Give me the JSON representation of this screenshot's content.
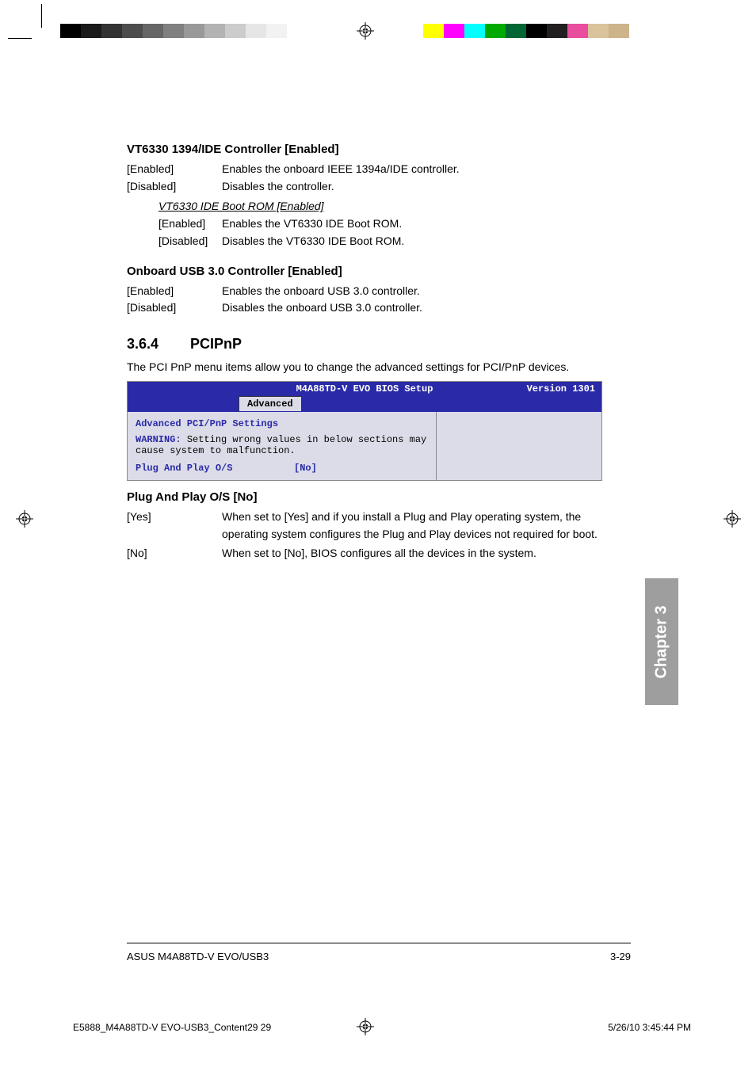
{
  "sections": {
    "vt6330": {
      "heading": "VT6330 1394/IDE Controller [Enabled]",
      "rows": [
        {
          "key": "[Enabled]",
          "val": "Enables the onboard IEEE 1394a/IDE controller."
        },
        {
          "key": "[Disabled]",
          "val": "Disables the controller."
        }
      ],
      "sub": {
        "heading": "VT6330 IDE Boot ROM [Enabled]",
        "rows": [
          {
            "key": "[Enabled]",
            "val": "Enables the VT6330 IDE Boot ROM."
          },
          {
            "key": "[Disabled]",
            "val": "Disables the VT6330 IDE Boot ROM."
          }
        ]
      }
    },
    "usb3": {
      "heading": "Onboard USB 3.0 Controller [Enabled]",
      "rows": [
        {
          "key": "[Enabled]",
          "val": "Enables the onboard USB 3.0 controller."
        },
        {
          "key": "[Disabled]",
          "val": "Disables the onboard USB 3.0 controller."
        }
      ]
    },
    "pcipnp": {
      "num": "3.6.4",
      "title": "PCIPnP",
      "intro": "The PCI PnP menu items allow you to change the advanced settings for PCI/PnP devices."
    },
    "plug": {
      "heading": "Plug And Play O/S [No]",
      "rows": [
        {
          "key": "[Yes]",
          "val": "When set to [Yes] and if you install a Plug and Play operating system, the operating system configures the Plug and Play devices not required for boot."
        },
        {
          "key": "[No]",
          "val": "When set to [No], BIOS configures all the devices in the system."
        }
      ]
    }
  },
  "bios": {
    "title": "M4A88TD-V EVO BIOS Setup",
    "version": "Version 1301",
    "tab": "Advanced",
    "panel_heading": "Advanced PCI/PnP Settings",
    "warning_label": "WARNING:",
    "warning_text": "Setting wrong values in below sections may cause system to malfunction.",
    "item_label": "Plug And Play O/S",
    "item_value": "[No]"
  },
  "chapter_tab": "Chapter 3",
  "footer": {
    "left": "ASUS M4A88TD-V EVO/USB3",
    "right": "3-29"
  },
  "slug": {
    "left": "E5888_M4A88TD-V EVO-USB3_Content29   29",
    "right": "5/26/10   3:45:44 PM"
  }
}
